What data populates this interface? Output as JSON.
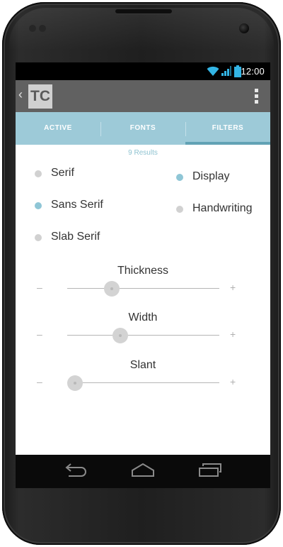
{
  "status_bar": {
    "time": "12:00",
    "icons": [
      "wifi-icon",
      "signal-icon",
      "battery-icon"
    ]
  },
  "action_bar": {
    "logo_text": "TC",
    "back_icon": "chevron-left-icon",
    "menu_icon": "overflow-menu-icon"
  },
  "tabs": [
    {
      "label": "ACTIVE",
      "selected": false
    },
    {
      "label": "FONTS",
      "selected": false
    },
    {
      "label": "FILTERS",
      "selected": true
    }
  ],
  "results": "9 Results",
  "filters": [
    {
      "label": "Serif",
      "selected": false
    },
    {
      "label": "Sans Serif",
      "selected": true
    },
    {
      "label": "Slab Serif",
      "selected": false
    },
    {
      "label": "Display",
      "selected": true
    },
    {
      "label": "Handwriting",
      "selected": false
    }
  ],
  "sliders": [
    {
      "label": "Thickness",
      "minus": "–",
      "plus": "+",
      "value": 0.27
    },
    {
      "label": "Width",
      "minus": "–",
      "plus": "+",
      "value": 0.33
    },
    {
      "label": "Slant",
      "minus": "–",
      "plus": "+",
      "value": 0.0
    }
  ],
  "nav_bar": {
    "icons": [
      "back-icon",
      "home-icon",
      "recent-apps-icon"
    ]
  },
  "colors": {
    "tab_bar": "#9dcad8",
    "tab_indicator": "#62a2b5",
    "action_bar": "#616161",
    "selected_dot": "#8fc6d6",
    "unselected_dot": "#d1d1d1",
    "results_text": "#8fc3d1"
  }
}
